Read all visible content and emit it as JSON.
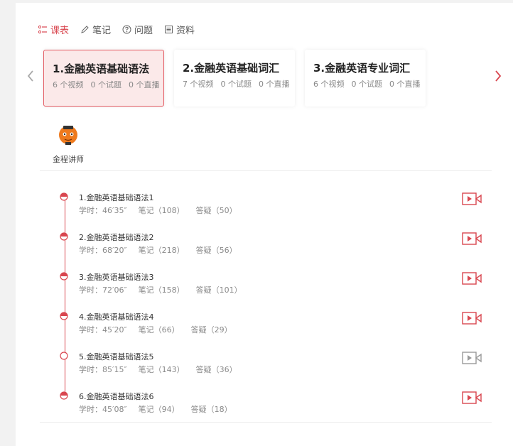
{
  "tabs": [
    {
      "label": "课表",
      "icon": "list-icon",
      "active": true
    },
    {
      "label": "笔记",
      "icon": "pencil-icon",
      "active": false
    },
    {
      "label": "问题",
      "icon": "question-icon",
      "active": false
    },
    {
      "label": "资料",
      "icon": "document-icon",
      "active": false
    }
  ],
  "courses": [
    {
      "title": "1.金融英语基础语法",
      "videos": "6 个视频",
      "tests": "0 个试题",
      "lives": "0 个直播",
      "active": true
    },
    {
      "title": "2.金融英语基础词汇",
      "videos": "7 个视频",
      "tests": "0 个试题",
      "lives": "0 个直播",
      "active": false
    },
    {
      "title": "3.金融英语专业词汇",
      "videos": "6 个视频",
      "tests": "0 个试题",
      "lives": "0 个直播",
      "active": false
    }
  ],
  "teacher": {
    "name": "金程讲师"
  },
  "lessons": [
    {
      "title": "1.金融英语基础语法1",
      "time": "学时：46′35″",
      "notes": "笔记（108）",
      "qa": "答疑（50）",
      "status": "half",
      "icon_state": "active"
    },
    {
      "title": "2.金融英语基础语法2",
      "time": "学时：68′20″",
      "notes": "笔记（218）",
      "qa": "答疑（56）",
      "status": "half",
      "icon_state": "active"
    },
    {
      "title": "3.金融英语基础语法3",
      "time": "学时：72′06″",
      "notes": "笔记（158）",
      "qa": "答疑（101）",
      "status": "half",
      "icon_state": "active"
    },
    {
      "title": "4.金融英语基础语法4",
      "time": "学时：45′20″",
      "notes": "笔记（66）",
      "qa": "答疑（29）",
      "status": "half",
      "icon_state": "active"
    },
    {
      "title": "5.金融英语基础语法5",
      "time": "学时：85′15″",
      "notes": "笔记（143）",
      "qa": "答疑（36）",
      "status": "empty",
      "icon_state": "inactive"
    },
    {
      "title": "6.金融英语基础语法6",
      "time": "学时：45′08″",
      "notes": "笔记（94）",
      "qa": "答疑（18）",
      "status": "half",
      "icon_state": "active"
    }
  ],
  "colors": {
    "accent": "#d9464f",
    "inactive": "#9a9a9a"
  }
}
